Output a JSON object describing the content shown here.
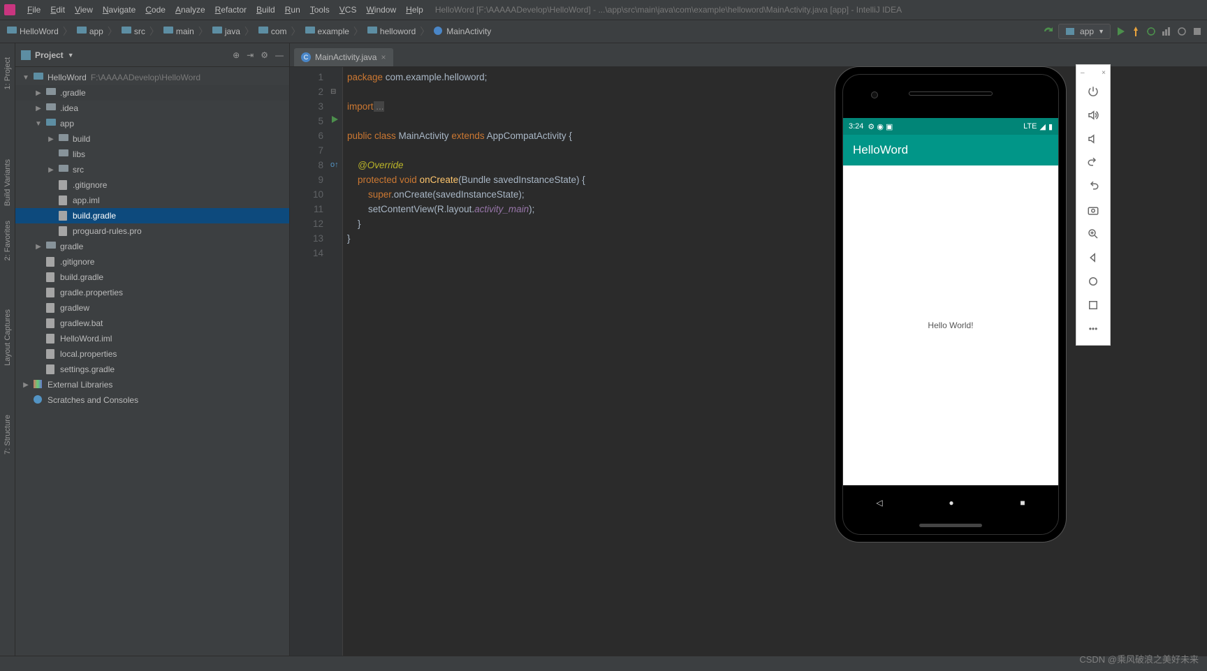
{
  "menu": {
    "items": [
      "File",
      "Edit",
      "View",
      "Navigate",
      "Code",
      "Analyze",
      "Refactor",
      "Build",
      "Run",
      "Tools",
      "VCS",
      "Window",
      "Help"
    ],
    "title": "HelloWord [F:\\AAAAADevelop\\HelloWord] - ...\\app\\src\\main\\java\\com\\example\\helloword\\MainActivity.java [app] - IntelliJ IDEA"
  },
  "breadcrumbs": [
    "HelloWord",
    "app",
    "src",
    "main",
    "java",
    "com",
    "example",
    "helloword",
    "MainActivity"
  ],
  "run_config": "app",
  "sidebar": {
    "title": "Project",
    "nodes": [
      {
        "d": 0,
        "chev": "▼",
        "ico": "root",
        "label": "HelloWord",
        "dim": "F:\\AAAAADevelop\\HelloWord"
      },
      {
        "d": 1,
        "chev": "▶",
        "ico": "folder",
        "label": ".gradle",
        "sel": false,
        "hl": true
      },
      {
        "d": 1,
        "chev": "▶",
        "ico": "folder",
        "label": ".idea"
      },
      {
        "d": 1,
        "chev": "▼",
        "ico": "blue",
        "label": "app"
      },
      {
        "d": 2,
        "chev": "▶",
        "ico": "folder",
        "label": "build"
      },
      {
        "d": 2,
        "chev": "",
        "ico": "folder",
        "label": "libs"
      },
      {
        "d": 2,
        "chev": "▶",
        "ico": "folder",
        "label": "src"
      },
      {
        "d": 2,
        "chev": "",
        "ico": "file",
        "label": ".gitignore"
      },
      {
        "d": 2,
        "chev": "",
        "ico": "file",
        "label": "app.iml"
      },
      {
        "d": 2,
        "chev": "",
        "ico": "file",
        "label": "build.gradle",
        "sel": true
      },
      {
        "d": 2,
        "chev": "",
        "ico": "file",
        "label": "proguard-rules.pro"
      },
      {
        "d": 1,
        "chev": "▶",
        "ico": "folder",
        "label": "gradle"
      },
      {
        "d": 1,
        "chev": "",
        "ico": "file",
        "label": ".gitignore"
      },
      {
        "d": 1,
        "chev": "",
        "ico": "file",
        "label": "build.gradle"
      },
      {
        "d": 1,
        "chev": "",
        "ico": "file",
        "label": "gradle.properties"
      },
      {
        "d": 1,
        "chev": "",
        "ico": "file",
        "label": "gradlew"
      },
      {
        "d": 1,
        "chev": "",
        "ico": "file",
        "label": "gradlew.bat"
      },
      {
        "d": 1,
        "chev": "",
        "ico": "file",
        "label": "HelloWord.iml"
      },
      {
        "d": 1,
        "chev": "",
        "ico": "file",
        "label": "local.properties"
      },
      {
        "d": 1,
        "chev": "",
        "ico": "file",
        "label": "settings.gradle"
      },
      {
        "d": 0,
        "chev": "▶",
        "ico": "lib",
        "label": "External Libraries"
      },
      {
        "d": 0,
        "chev": "",
        "ico": "scratch",
        "label": "Scratches and Consoles"
      }
    ]
  },
  "left_tabs": [
    "1: Project",
    "Build Variants",
    "2: Favorites",
    "Layout Captures",
    "7: Structure"
  ],
  "tab": {
    "file": "MainActivity.java"
  },
  "code": {
    "lines": [
      1,
      2,
      3,
      5,
      6,
      7,
      8,
      9,
      10,
      11,
      12,
      13,
      14
    ],
    "l1": "package",
    "l1b": " com.example.helloword;",
    "l3": "import",
    "l3b": " ...",
    "l6": "public class",
    "l6b": " MainActivity ",
    "l6c": "extends",
    "l6d": " AppCompatActivity {",
    "l8": "@Override",
    "l9": "protected void",
    "l9b": " onCreate",
    "l9c": "(Bundle savedInstanceState) {",
    "l10": "super",
    "l10b": ".onCreate(savedInstanceState);",
    "l11": "setContentView(R.layout.",
    "l11b": "activity_main",
    "l11c": ");",
    "l12": "}",
    "l13": "}"
  },
  "emulator": {
    "time": "3:24",
    "network": "LTE",
    "app_title": "HelloWord",
    "body_text": "Hello World!"
  },
  "watermark": "CSDN @乘风破浪之美好未来"
}
